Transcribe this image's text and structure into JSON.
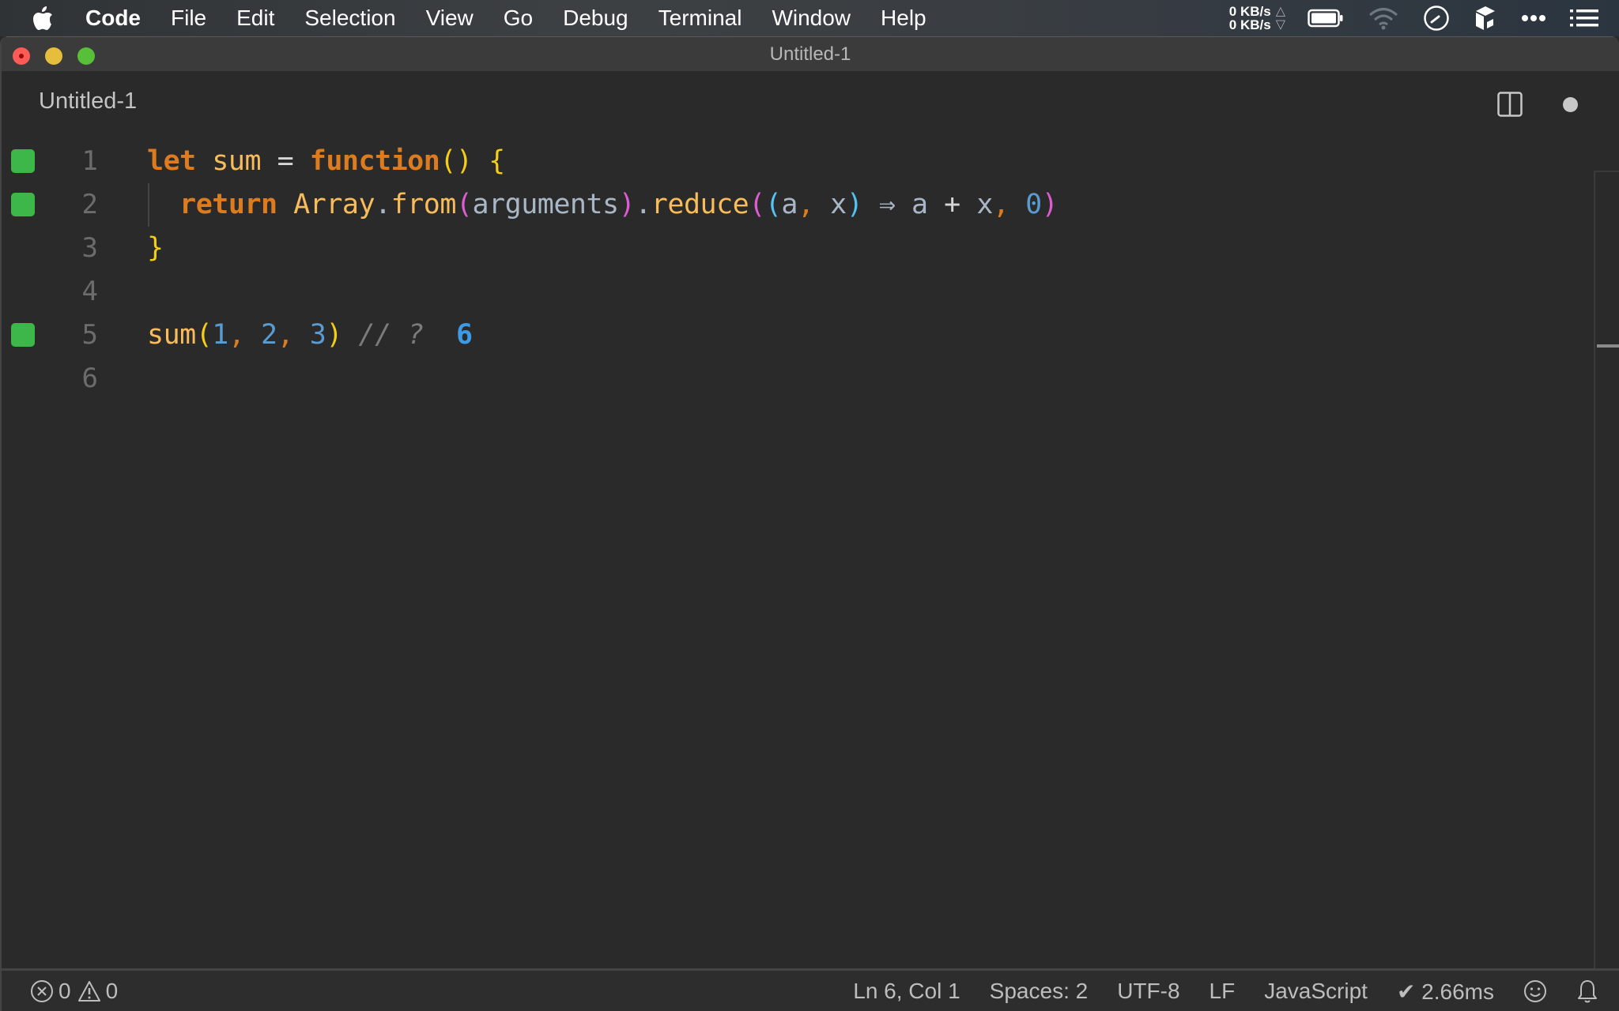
{
  "menubar": {
    "apple_icon": "apple-logo-icon",
    "items": [
      "Code",
      "File",
      "Edit",
      "Selection",
      "View",
      "Go",
      "Debug",
      "Terminal",
      "Window",
      "Help"
    ],
    "net_up": "0 KB/s",
    "net_down": "0 KB/s",
    "net_up_arrow": "△",
    "net_down_arrow": "▽",
    "tray_icons": [
      "battery-icon",
      "wifi-icon",
      "clock-icon",
      "box-icon",
      "more-icon",
      "list-icon"
    ]
  },
  "window": {
    "title": "Untitled-1"
  },
  "tab": {
    "label": "Untitled-1",
    "split_icon": "split-editor-icon",
    "dirty_indicator": "unsaved-dot"
  },
  "editor": {
    "lines": [
      {
        "number": "1",
        "marker": true,
        "tokens": [
          {
            "t": "let",
            "c": "kw"
          },
          {
            "t": " "
          },
          {
            "t": "sum",
            "c": "fn"
          },
          {
            "t": " "
          },
          {
            "t": "=",
            "c": "op"
          },
          {
            "t": " "
          },
          {
            "t": "function",
            "c": "kw"
          },
          {
            "t": "(",
            "c": "p1"
          },
          {
            "t": ")",
            "c": "p1"
          },
          {
            "t": " "
          },
          {
            "t": "{",
            "c": "p1"
          }
        ]
      },
      {
        "number": "2",
        "marker": true,
        "tokens": [
          {
            "t": "  "
          },
          {
            "t": "return",
            "c": "kw"
          },
          {
            "t": " "
          },
          {
            "t": "Array",
            "c": "fn"
          },
          {
            "t": ".",
            "c": "var"
          },
          {
            "t": "from",
            "c": "fn"
          },
          {
            "t": "(",
            "c": "p2"
          },
          {
            "t": "arguments",
            "c": "var"
          },
          {
            "t": ")",
            "c": "p2"
          },
          {
            "t": ".",
            "c": "var"
          },
          {
            "t": "reduce",
            "c": "fn"
          },
          {
            "t": "(",
            "c": "p2"
          },
          {
            "t": "(",
            "c": "p3"
          },
          {
            "t": "a",
            "c": "var"
          },
          {
            "t": ",",
            "c": "comma"
          },
          {
            "t": " "
          },
          {
            "t": "x",
            "c": "var"
          },
          {
            "t": ")",
            "c": "p3"
          },
          {
            "t": " "
          },
          {
            "t": "⇒",
            "c": "var"
          },
          {
            "t": " "
          },
          {
            "t": "a",
            "c": "var"
          },
          {
            "t": " "
          },
          {
            "t": "+",
            "c": "op"
          },
          {
            "t": " "
          },
          {
            "t": "x",
            "c": "var"
          },
          {
            "t": ",",
            "c": "comma"
          },
          {
            "t": " "
          },
          {
            "t": "0",
            "c": "num"
          },
          {
            "t": ")",
            "c": "p2"
          }
        ]
      },
      {
        "number": "3",
        "marker": false,
        "tokens": [
          {
            "t": "}",
            "c": "p1"
          }
        ]
      },
      {
        "number": "4",
        "marker": false,
        "tokens": []
      },
      {
        "number": "5",
        "marker": true,
        "tokens": [
          {
            "t": "sum",
            "c": "fn"
          },
          {
            "t": "(",
            "c": "p1"
          },
          {
            "t": "1",
            "c": "num"
          },
          {
            "t": ",",
            "c": "comma"
          },
          {
            "t": " "
          },
          {
            "t": "2",
            "c": "num"
          },
          {
            "t": ",",
            "c": "comma"
          },
          {
            "t": " "
          },
          {
            "t": "3",
            "c": "num"
          },
          {
            "t": ")",
            "c": "p1"
          },
          {
            "t": " "
          },
          {
            "t": "// ?",
            "c": "cmt"
          },
          {
            "t": "  "
          },
          {
            "t": "6",
            "c": "result"
          }
        ]
      },
      {
        "number": "6",
        "marker": false,
        "current": true,
        "tokens": []
      }
    ],
    "marker_color": "#3db64a"
  },
  "statusbar": {
    "errors": "0",
    "warnings": "0",
    "position": "Ln 6, Col 1",
    "indent": "Spaces: 2",
    "encoding": "UTF-8",
    "eol": "LF",
    "language": "JavaScript",
    "timing": "✔ 2.66ms",
    "feedback_icon": "smiley-icon",
    "notifications_icon": "bell-icon"
  }
}
